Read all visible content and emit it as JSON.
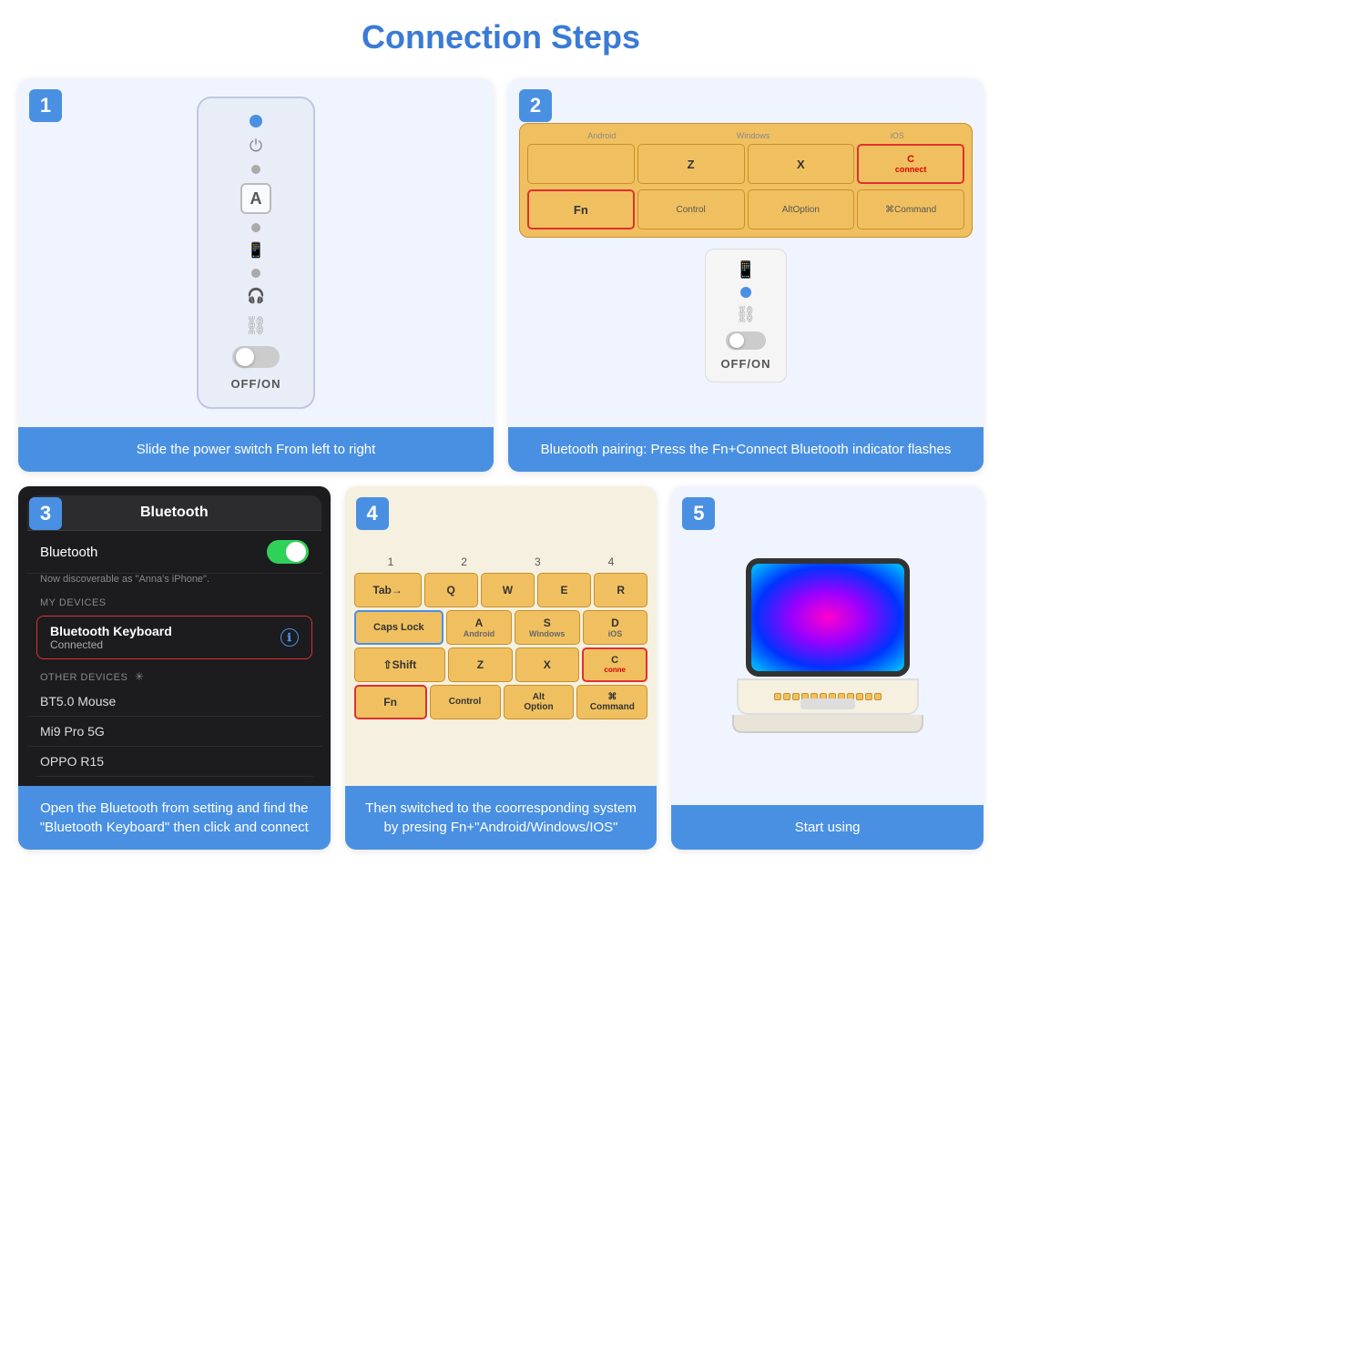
{
  "title": "Connection Steps",
  "steps": [
    {
      "number": "1",
      "description": "Slide the power switch\nFrom left to right",
      "off_on_label": "OFF/ON"
    },
    {
      "number": "2",
      "description": "Bluetooth pairing: Press the Fn+Connect\nBluetooth indicator flashes",
      "keys": {
        "row1": [
          "",
          "Z",
          "X",
          "C connect"
        ],
        "row2": [
          "Fn",
          "Control",
          "Alt Option",
          "⌘ Command"
        ]
      },
      "off_on_label": "OFF/ON"
    },
    {
      "number": "3",
      "description": "Open the Bluetooth from setting and find the \"Bluetooth Keyboard\" then click and connect",
      "bluetooth": {
        "header": "Bluetooth",
        "bt_label": "Bluetooth",
        "discoverable": "Now discoverable as \"Anna's iPhone\".",
        "my_devices_header": "MY DEVICES",
        "device_name": "Bluetooth Keyboard",
        "device_status": "Connected",
        "other_devices_header": "OTHER DEVICES",
        "other_devices": [
          "BT5.0 Mouse",
          "Mi9 Pro 5G",
          "OPPO R15"
        ]
      }
    },
    {
      "number": "4",
      "description": "Then switched to the coorresponding system by presing Fn+\"Android/Windows/IOS\"",
      "num_row": [
        "1",
        "2",
        "3",
        "4"
      ],
      "keys": {
        "row1_labels": [
          "Tab→",
          "Q",
          "W",
          "E",
          "R"
        ],
        "row2_labels": [
          "Caps Lock",
          "A Android",
          "S Windows",
          "D iOS"
        ],
        "row3_labels": [
          "⇧Shift",
          "Z",
          "X",
          "C conne"
        ],
        "row4_labels": [
          "Fn",
          "Control",
          "Alt Option",
          "⌘ Command"
        ]
      }
    },
    {
      "number": "5",
      "description": "Start using"
    }
  ]
}
